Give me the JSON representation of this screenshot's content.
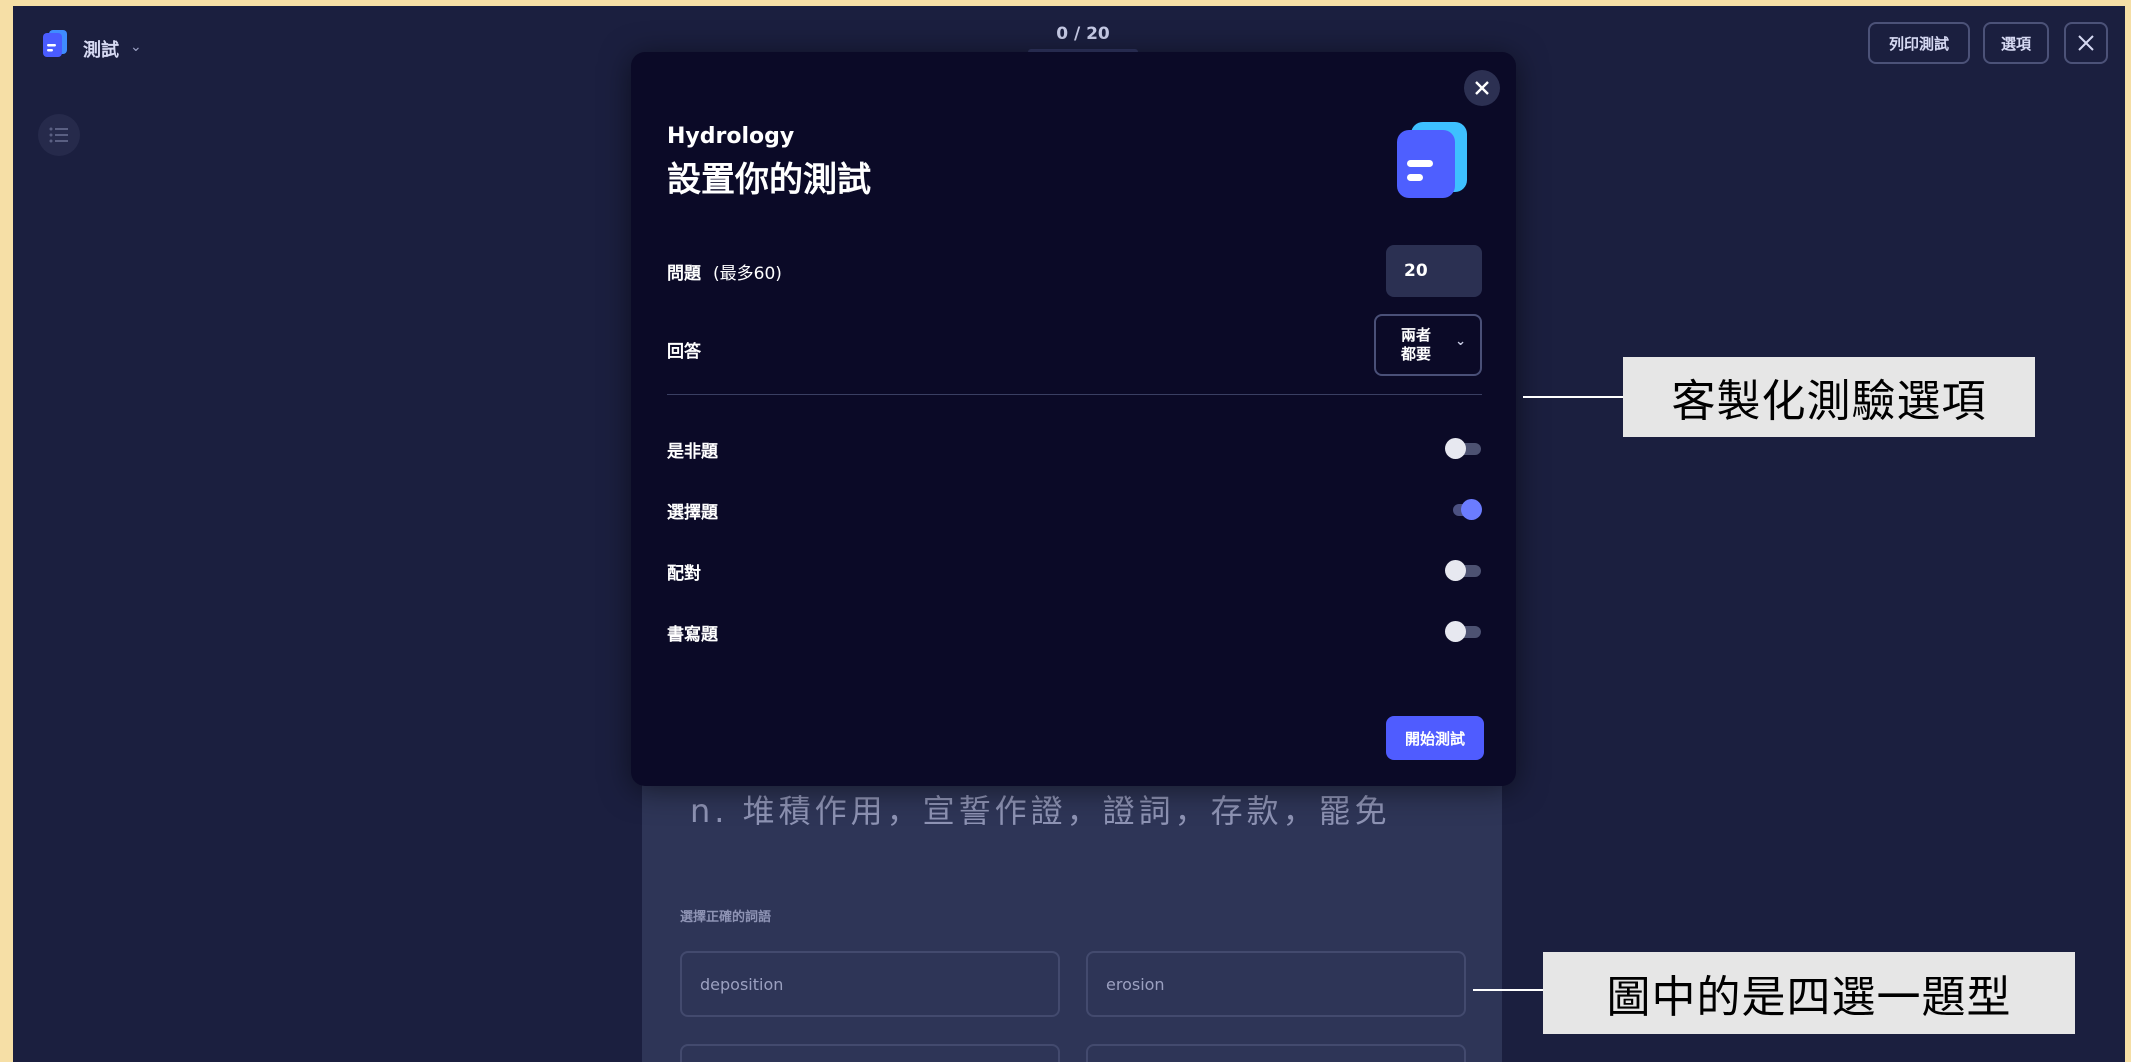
{
  "header": {
    "quiz_label": "測試",
    "progress": "0 / 20",
    "print_button": "列印測試",
    "options_button": "選項"
  },
  "background_question": {
    "text": "n. 堆積作用，宣誓作證，證詞，存款，罷免",
    "prompt": "選擇正確的詞語",
    "options": [
      "deposition",
      "erosion",
      "",
      ""
    ]
  },
  "modal": {
    "subject": "Hydrology",
    "title": "設置你的測試",
    "questions_label": "問題",
    "questions_hint": "(最多60)",
    "questions_value": "20",
    "answer_label": "回答",
    "answer_value": "兩者都要",
    "answer_value_line1": "兩者",
    "answer_value_line2": "都要",
    "question_types": [
      {
        "label": "是非題",
        "enabled": false
      },
      {
        "label": "選擇題",
        "enabled": true
      },
      {
        "label": "配對",
        "enabled": false
      },
      {
        "label": "書寫題",
        "enabled": false
      }
    ],
    "start_button": "開始測試"
  },
  "annotations": {
    "customize": "客製化測驗選項",
    "question_type": "圖中的是四選一題型"
  },
  "colors": {
    "background": "#1b1f3f",
    "modal": "#0b0a27",
    "accent": "#4f5cff",
    "toggle_on": "#6b7cff",
    "frame": "#f6dfa6"
  }
}
